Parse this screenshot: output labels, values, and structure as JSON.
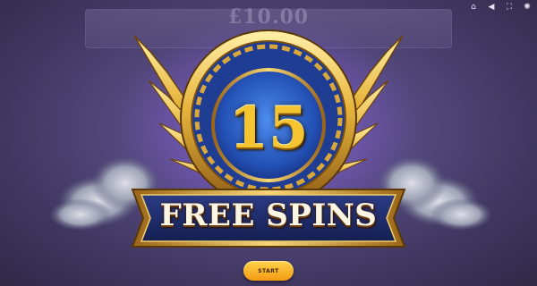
{
  "game": {
    "stake": "£10.00"
  },
  "controls": [
    {
      "name": "home-icon",
      "glyph": "⌂"
    },
    {
      "name": "sound-icon",
      "glyph": "◀"
    },
    {
      "name": "fullscreen-icon",
      "glyph": "⛶"
    },
    {
      "name": "settings-icon",
      "glyph": "✺"
    }
  ],
  "feature": {
    "spins_count": "15",
    "title": "FREE SPINS"
  },
  "buttons": {
    "start": "START"
  },
  "colors": {
    "gold": "#f4c431",
    "medallion_blue": "#2f5fc4",
    "banner_navy": "#1c2a66",
    "button_orange": "#f5a418",
    "background_purple": "#54497e"
  }
}
